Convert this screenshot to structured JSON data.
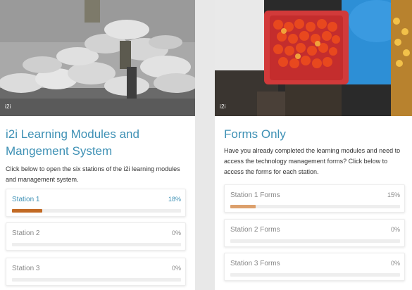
{
  "left_card": {
    "hero_tag": "i2i",
    "title": "i2i Learning Modules and Mangement System",
    "description": "Click below to open the six stations of the i2i learning modules and management system.",
    "stations": [
      {
        "label": "Station 1",
        "percent_text": "18%",
        "progress": 0.18
      },
      {
        "label": "Station 2",
        "percent_text": "0%",
        "progress": 0
      },
      {
        "label": "Station 3",
        "percent_text": "0%",
        "progress": 0
      }
    ]
  },
  "right_card": {
    "hero_tag": "i2i",
    "title": "Forms Only",
    "description": "Have you already completed the learning modules and need to access the technology management forms? Click below to access the forms for each station.",
    "forms": [
      {
        "label": "Station 1 Forms",
        "percent_text": "15%",
        "progress": 0.15
      },
      {
        "label": "Station 2 Forms",
        "percent_text": "0%",
        "progress": 0
      },
      {
        "label": "Station 3 Forms",
        "percent_text": "0%",
        "progress": 0
      }
    ]
  },
  "colors": {
    "accent_blue": "#3f91b5",
    "progress_active": "#c26a24",
    "progress_forms": "#dca06c",
    "track": "#eeeeee"
  }
}
